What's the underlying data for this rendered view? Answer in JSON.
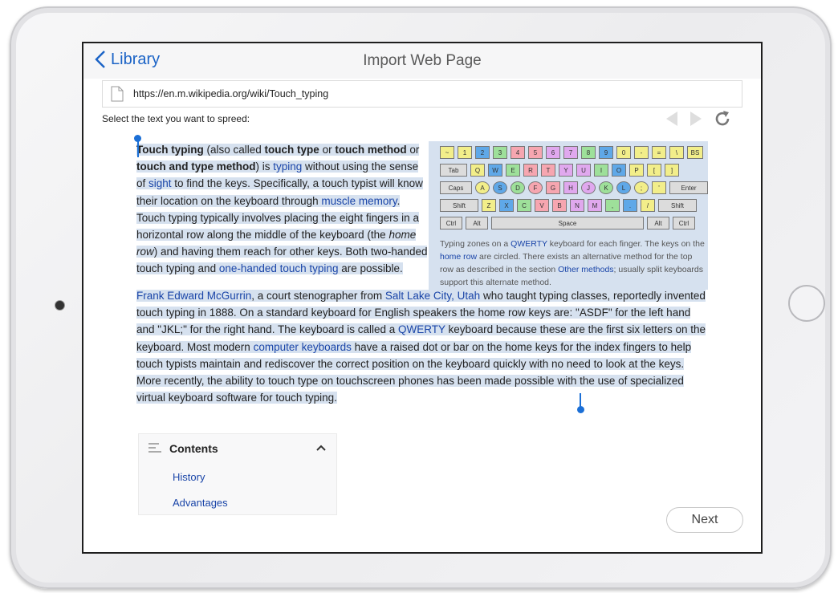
{
  "nav": {
    "back_label": "Library",
    "title": "Import Web Page"
  },
  "url": {
    "value": "https://en.m.wikipedia.org/wiki/Touch_typing"
  },
  "instruction": "Select the text you want to spreed:",
  "article": {
    "p1": [
      {
        "t": "Touch typing",
        "b": true
      },
      {
        "t": " (also called "
      },
      {
        "t": "touch type",
        "b": true
      },
      {
        "t": " or "
      },
      {
        "t": "touch method",
        "b": true
      },
      {
        "t": " or "
      },
      {
        "t": "touch and type method",
        "b": true
      },
      {
        "t": ") is "
      },
      {
        "t": "typing",
        "l": true
      },
      {
        "t": " without using the sense of "
      },
      {
        "t": "sight",
        "l": true
      },
      {
        "t": " to find the keys. Specifically, a touch typist will know their location on the keyboard through "
      },
      {
        "t": "muscle memory",
        "l": true
      },
      {
        "t": ". Touch typing typically involves placing the eight fingers in a horizontal row along the middle of the keyboard (the "
      },
      {
        "t": "home row",
        "i": true
      },
      {
        "t": ") and having them reach for other keys. Both two-handed touch typing and "
      },
      {
        "t": "one-handed touch typing",
        "l": true
      },
      {
        "t": " are possible."
      }
    ],
    "p2": [
      {
        "t": "Frank Edward McGurrin",
        "l": true
      },
      {
        "t": ", a court stenographer from "
      },
      {
        "t": "Salt Lake City, Utah",
        "l": true
      },
      {
        "t": " who taught typing classes, reportedly invented touch typing in 1888. On a standard keyboard for English speakers the home row keys are: \"ASDF\" for the left hand and \"JKL;\" for the right hand. The keyboard is called a "
      },
      {
        "t": "QWERTY",
        "l": true
      },
      {
        "t": " keyboard because these are the first six letters on the keyboard. Most modern "
      },
      {
        "t": "computer keyboards",
        "l": true
      },
      {
        "t": " have a raised dot or bar on the home keys for the index fingers to help touch typists maintain and rediscover the correct position on the keyboard quickly with no need to look at the keys. More recently, the ability to touch type on touchscreen phones has been made possible with the use of specialized virtual keyboard software for touch typing."
      }
    ],
    "caption": [
      {
        "t": "Typing zones on a "
      },
      {
        "t": "QWERTY",
        "l": true
      },
      {
        "t": " keyboard for each finger. The keys on the "
      },
      {
        "t": "home row",
        "l": true
      },
      {
        "t": " are circled. There exists an alternative method for the top row as described in the section "
      },
      {
        "t": "Other methods",
        "l": true
      },
      {
        "t": "; usually split keyboards support this alternate method."
      }
    ]
  },
  "keyboard": {
    "rows": [
      [
        {
          "k": "~",
          "c": "#f2ee8a"
        },
        {
          "k": "1",
          "c": "#f2ee8a"
        },
        {
          "k": "2",
          "c": "#5fa8e8"
        },
        {
          "k": "3",
          "c": "#9ee09a"
        },
        {
          "k": "4",
          "c": "#f6a6b0"
        },
        {
          "k": "5",
          "c": "#f6a6b0"
        },
        {
          "k": "6",
          "c": "#e0a8ee"
        },
        {
          "k": "7",
          "c": "#e0a8ee"
        },
        {
          "k": "8",
          "c": "#9ee09a"
        },
        {
          "k": "9",
          "c": "#5fa8e8"
        },
        {
          "k": "0",
          "c": "#f2ee8a"
        },
        {
          "k": "-",
          "c": "#f2ee8a"
        },
        {
          "k": "=",
          "c": "#f2ee8a"
        },
        {
          "k": "\\",
          "c": "#f2ee8a"
        },
        {
          "k": "BS",
          "c": "#f2ee8a"
        }
      ],
      [
        {
          "k": "Tab",
          "c": "#dcdcdc"
        },
        {
          "k": "Q",
          "c": "#f2ee8a"
        },
        {
          "k": "W",
          "c": "#5fa8e8"
        },
        {
          "k": "E",
          "c": "#9ee09a"
        },
        {
          "k": "R",
          "c": "#f6a6b0"
        },
        {
          "k": "T",
          "c": "#f6a6b0"
        },
        {
          "k": "Y",
          "c": "#e0a8ee"
        },
        {
          "k": "U",
          "c": "#e0a8ee"
        },
        {
          "k": "I",
          "c": "#9ee09a"
        },
        {
          "k": "O",
          "c": "#5fa8e8"
        },
        {
          "k": "P",
          "c": "#f2ee8a"
        },
        {
          "k": "[",
          "c": "#f2ee8a"
        },
        {
          "k": "]",
          "c": "#f2ee8a"
        }
      ],
      [
        {
          "k": "Caps",
          "c": "#dcdcdc"
        },
        {
          "k": "A",
          "c": "#f2ee8a"
        },
        {
          "k": "S",
          "c": "#5fa8e8"
        },
        {
          "k": "D",
          "c": "#9ee09a"
        },
        {
          "k": "F",
          "c": "#f6a6b0"
        },
        {
          "k": "G",
          "c": "#f6a6b0"
        },
        {
          "k": "H",
          "c": "#e0a8ee"
        },
        {
          "k": "J",
          "c": "#e0a8ee"
        },
        {
          "k": "K",
          "c": "#9ee09a"
        },
        {
          "k": "L",
          "c": "#5fa8e8"
        },
        {
          "k": ";",
          "c": "#f2ee8a"
        },
        {
          "k": "'",
          "c": "#f2ee8a"
        },
        {
          "k": "Enter",
          "c": "#dcdcdc"
        }
      ],
      [
        {
          "k": "Shift",
          "c": "#dcdcdc"
        },
        {
          "k": "Z",
          "c": "#f2ee8a"
        },
        {
          "k": "X",
          "c": "#5fa8e8"
        },
        {
          "k": "C",
          "c": "#9ee09a"
        },
        {
          "k": "V",
          "c": "#f6a6b0"
        },
        {
          "k": "B",
          "c": "#f6a6b0"
        },
        {
          "k": "N",
          "c": "#e0a8ee"
        },
        {
          "k": "M",
          "c": "#e0a8ee"
        },
        {
          "k": ",",
          "c": "#9ee09a"
        },
        {
          "k": ".",
          "c": "#5fa8e8"
        },
        {
          "k": "/",
          "c": "#f2ee8a"
        },
        {
          "k": "Shift",
          "c": "#dcdcdc"
        }
      ],
      [
        {
          "k": "Ctrl",
          "c": "#dcdcdc"
        },
        {
          "k": "Alt",
          "c": "#dcdcdc"
        },
        {
          "k": "Space",
          "c": "#dcdcdc"
        },
        {
          "k": "Alt",
          "c": "#dcdcdc"
        },
        {
          "k": "Ctrl",
          "c": "#dcdcdc"
        }
      ]
    ]
  },
  "toc": {
    "title": "Contents",
    "items": [
      "History",
      "Advantages"
    ]
  },
  "next_label": "Next",
  "colors": {
    "accent": "#1b63c6",
    "selection": "#d6e1ef",
    "link": "#1a45a8"
  }
}
